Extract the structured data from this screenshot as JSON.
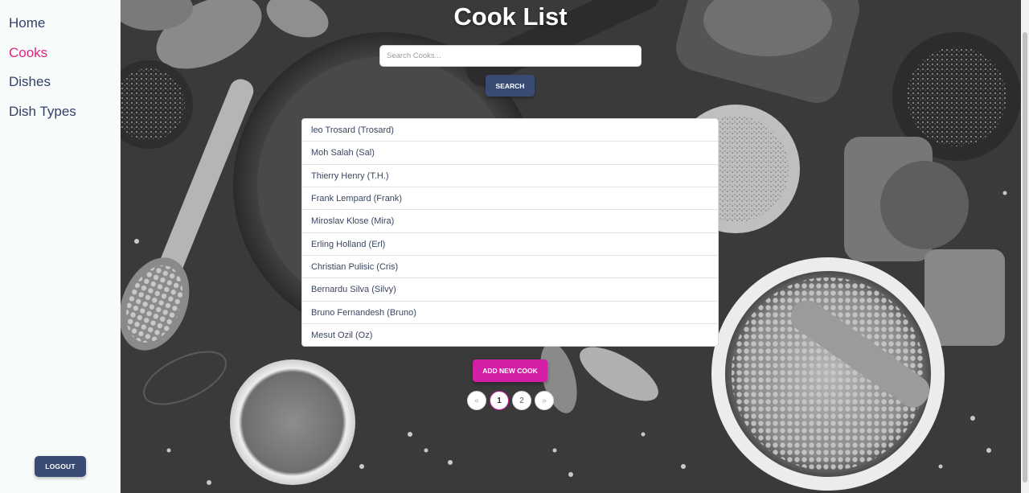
{
  "nav": {
    "items": [
      {
        "label": "Home",
        "active": false
      },
      {
        "label": "Cooks",
        "active": true
      },
      {
        "label": "Dishes",
        "active": false
      },
      {
        "label": "Dish Types",
        "active": false
      }
    ],
    "logout_label": "LOGOUT"
  },
  "page": {
    "title": "Cook List",
    "search_placeholder": "Search Cooks...",
    "search_value": "",
    "search_label": "SEARCH",
    "add_label": "ADD NEW COOK"
  },
  "cooks": [
    "leo Trosard (Trosard)",
    "Moh Salah (Sal)",
    "Thierry Henry (T.H.)",
    "Frank Lempard (Frank)",
    "Miroslav Klose (Mira)",
    "Erling Holland (Erl)",
    "Christian Pulisic (Cris)",
    "Bernardu Silva (Silvy)",
    "Bruno Fernandesh (Bruno)",
    "Mesut Ozil (Oz)"
  ],
  "pagination": {
    "prev": "«",
    "pages": [
      "1",
      "2"
    ],
    "current": "1",
    "next": "»"
  },
  "colors": {
    "accent": "#e0247e",
    "primary_button": "#3a4b73",
    "add_button": "#d21fa6"
  }
}
